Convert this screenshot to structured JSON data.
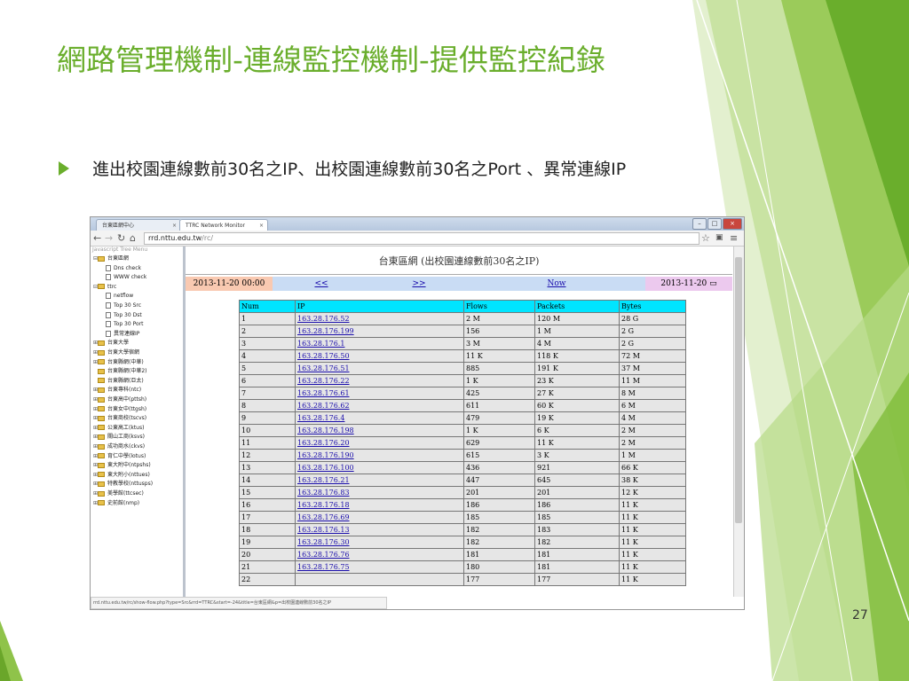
{
  "slide": {
    "title": "網路管理機制-連線監控機制-提供監控紀錄",
    "bullet": "進出校園連線數前30名之IP、出校園連線數前30名之Port 、異常連線IP",
    "page_number": "27",
    "accent_color": "#6aae2c"
  },
  "browser": {
    "tabs": [
      {
        "label": "台東區網中心",
        "active": false
      },
      {
        "label": "TTRC Network Monitor",
        "active": true
      }
    ],
    "url_host": "rrd.nttu.edu.tw",
    "url_path": "/rc/",
    "status_url": "rrd.nttu.edu.tw/rc/show-flow.php?type=Src&rrd=TTRC&start=-24&title=台東區網&p=出校園連線數前30名之IP"
  },
  "sidebar": {
    "menu_title": "Javascript Tree Menu",
    "items": [
      {
        "label": "台東區網",
        "icon": "folder-icon",
        "level": 0,
        "expander": "⊟"
      },
      {
        "label": "Dns check",
        "icon": "document-icon",
        "level": 1,
        "expander": ""
      },
      {
        "label": "WWW check",
        "icon": "document-icon",
        "level": 1,
        "expander": ""
      },
      {
        "label": "ttrc",
        "icon": "folder-icon",
        "level": 0,
        "expander": "⊟"
      },
      {
        "label": "netflow",
        "icon": "document-icon",
        "level": 1,
        "expander": ""
      },
      {
        "label": "Top 30 Src",
        "icon": "document-icon",
        "level": 1,
        "expander": ""
      },
      {
        "label": "Top 30 Dst",
        "icon": "document-icon",
        "level": 1,
        "expander": ""
      },
      {
        "label": "Top 30 Port",
        "icon": "document-icon",
        "level": 1,
        "expander": ""
      },
      {
        "label": "異常連線IP",
        "icon": "document-icon",
        "level": 1,
        "expander": ""
      },
      {
        "label": "台東大學",
        "icon": "folder-icon",
        "level": 0,
        "expander": "⊞"
      },
      {
        "label": "台東大學宿網",
        "icon": "folder-icon",
        "level": 0,
        "expander": "⊞"
      },
      {
        "label": "台東縣網(中華)",
        "icon": "folder-icon",
        "level": 0,
        "expander": "⊞"
      },
      {
        "label": "台東縣網(中華2)",
        "icon": "folder-icon",
        "level": 0,
        "expander": ""
      },
      {
        "label": "台東縣網(亞太)",
        "icon": "folder-icon",
        "level": 0,
        "expander": ""
      },
      {
        "label": "台東專科(ntc)",
        "icon": "folder-icon",
        "level": 0,
        "expander": "⊞"
      },
      {
        "label": "台東高中(pttsh)",
        "icon": "folder-icon",
        "level": 0,
        "expander": "⊞"
      },
      {
        "label": "台東女中(ttgsh)",
        "icon": "folder-icon",
        "level": 0,
        "expander": "⊞"
      },
      {
        "label": "台東商校(tscvs)",
        "icon": "folder-icon",
        "level": 0,
        "expander": "⊞"
      },
      {
        "label": "公東高工(ktus)",
        "icon": "folder-icon",
        "level": 0,
        "expander": "⊞"
      },
      {
        "label": "關山工商(ksvs)",
        "icon": "folder-icon",
        "level": 0,
        "expander": "⊞"
      },
      {
        "label": "成功商水(ckvs)",
        "icon": "folder-icon",
        "level": 0,
        "expander": "⊞"
      },
      {
        "label": "育仁中學(lotus)",
        "icon": "folder-icon",
        "level": 0,
        "expander": "⊞"
      },
      {
        "label": "東大附中(ntpshs)",
        "icon": "folder-icon",
        "level": 0,
        "expander": "⊞"
      },
      {
        "label": "東大附小(nttues)",
        "icon": "folder-icon",
        "level": 0,
        "expander": "⊞"
      },
      {
        "label": "特教學校(nttusps)",
        "icon": "folder-icon",
        "level": 0,
        "expander": "⊞"
      },
      {
        "label": "美學館(ttcsec)",
        "icon": "folder-icon",
        "level": 0,
        "expander": "⊞"
      },
      {
        "label": "史前館(nmp)",
        "icon": "folder-icon",
        "level": 0,
        "expander": "⊞"
      }
    ]
  },
  "report": {
    "heading": "台東區網 (出校園連線數前30名之IP)",
    "start_time": "2013-11-20 00:00",
    "prev_label": "<<",
    "next_label": ">>",
    "now_label": "Now",
    "end_time": "2013-11-20",
    "colors": {
      "start": "#f9c9b1",
      "nav": "#c9dcf4",
      "end": "#ecc9ee",
      "header": "#00e5ff"
    },
    "columns": [
      "Num",
      "IP",
      "Flows",
      "Packets",
      "Bytes"
    ],
    "rows": [
      [
        "1",
        "163.28.176.52",
        "2 M",
        "120 M",
        "28 G"
      ],
      [
        "2",
        "163.28.176.199",
        "156",
        "1 M",
        "2 G"
      ],
      [
        "3",
        "163.28.176.1",
        "3 M",
        "4 M",
        "2 G"
      ],
      [
        "4",
        "163.28.176.50",
        "11 K",
        "118 K",
        "72 M"
      ],
      [
        "5",
        "163.28.176.51",
        "885",
        "191 K",
        "37 M"
      ],
      [
        "6",
        "163.28.176.22",
        "1 K",
        "23 K",
        "11 M"
      ],
      [
        "7",
        "163.28.176.61",
        "425",
        "27 K",
        "8 M"
      ],
      [
        "8",
        "163.28.176.62",
        "611",
        "60 K",
        "6 M"
      ],
      [
        "9",
        "163.28.176.4",
        "479",
        "19 K",
        "4 M"
      ],
      [
        "10",
        "163.28.176.198",
        "1 K",
        "6 K",
        "2 M"
      ],
      [
        "11",
        "163.28.176.20",
        "629",
        "11 K",
        "2 M"
      ],
      [
        "12",
        "163.28.176.190",
        "615",
        "3 K",
        "1 M"
      ],
      [
        "13",
        "163.28.176.100",
        "436",
        "921",
        "66 K"
      ],
      [
        "14",
        "163.28.176.21",
        "447",
        "645",
        "38 K"
      ],
      [
        "15",
        "163.28.176.83",
        "201",
        "201",
        "12 K"
      ],
      [
        "16",
        "163.28.176.18",
        "186",
        "186",
        "11 K"
      ],
      [
        "17",
        "163.28.176.69",
        "185",
        "185",
        "11 K"
      ],
      [
        "18",
        "163.28.176.13",
        "182",
        "183",
        "11 K"
      ],
      [
        "19",
        "163.28.176.30",
        "182",
        "182",
        "11 K"
      ],
      [
        "20",
        "163.28.176.76",
        "181",
        "181",
        "11 K"
      ],
      [
        "21",
        "163.28.176.75",
        "180",
        "181",
        "11 K"
      ],
      [
        "22",
        "",
        "177",
        "177",
        "11 K"
      ]
    ]
  }
}
